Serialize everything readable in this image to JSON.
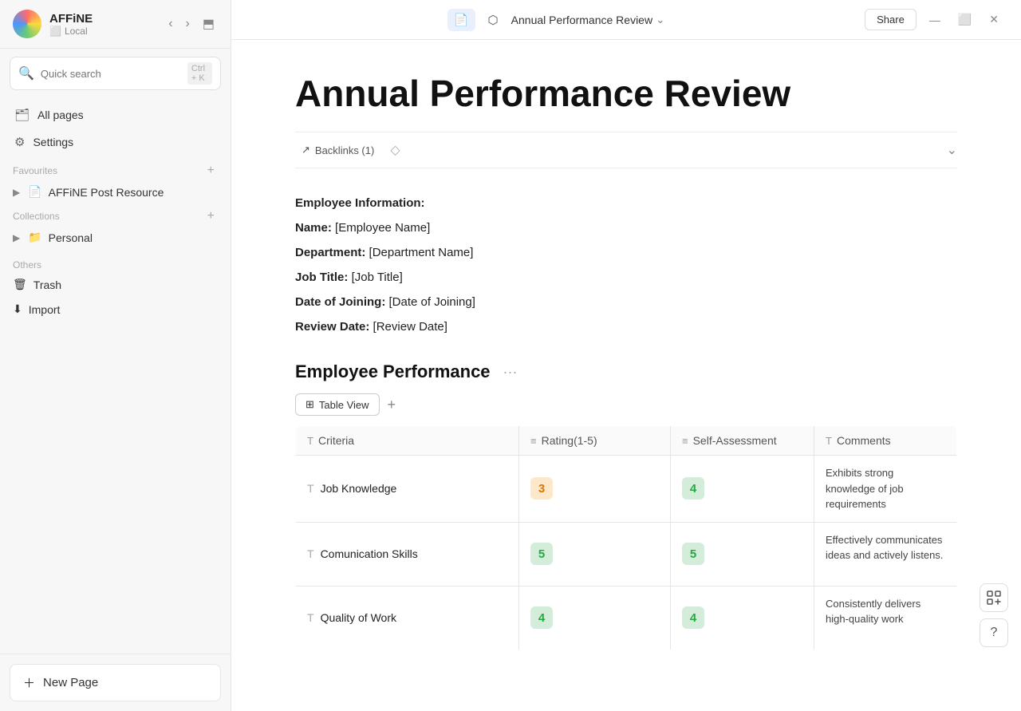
{
  "app": {
    "name": "AFFiNE",
    "workspace": "Local",
    "title": "Annual Performance Review"
  },
  "topbar": {
    "doc_icon": "📄",
    "graph_icon": "⬡",
    "share_label": "Share",
    "chevron_down": "⌄",
    "minimize": "—",
    "maximize": "⬜",
    "close": "✕"
  },
  "sidebar": {
    "search_placeholder": "Quick search",
    "search_shortcut": "Ctrl + K",
    "all_pages_label": "All pages",
    "settings_label": "Settings",
    "favourites_label": "Favourites",
    "favourites_item": "AFFiNE Post Resource",
    "collections_label": "Collections",
    "collections_item": "Personal",
    "others_label": "Others",
    "trash_label": "Trash",
    "import_label": "Import",
    "new_page_label": "New Page"
  },
  "document": {
    "title": "Annual Performance Review",
    "backlinks": "Backlinks (1)",
    "employee_info_heading": "Employee Information:",
    "name_label": "Name:",
    "name_value": "[Employee Name]",
    "department_label": "Department:",
    "department_value": "[Department Name]",
    "job_title_label": "Job Title:",
    "job_title_value": "[Job Title]",
    "date_of_joining_label": "Date of Joining:",
    "date_of_joining_value": "[Date of Joining]",
    "review_date_label": "Review Date:",
    "review_date_value": "[Review Date]"
  },
  "database": {
    "title": "Employee Performance",
    "view_label": "Table View",
    "add_view": "+",
    "columns": [
      {
        "label": "Criteria",
        "icon": "T"
      },
      {
        "label": "Rating(1-5)",
        "icon": "#"
      },
      {
        "label": "Self-Assessment",
        "icon": "#"
      },
      {
        "label": "Comments",
        "icon": "T"
      }
    ],
    "rows": [
      {
        "criteria": "Job Knowledge",
        "rating": "3",
        "rating_class": "badge-3",
        "self_assessment": "4",
        "self_class": "badge-4",
        "comment": "Exhibits strong knowledge of job requirements"
      },
      {
        "criteria": "Comunication Skills",
        "rating": "5",
        "rating_class": "badge-5",
        "self_assessment": "5",
        "self_class": "badge-5",
        "comment": "Effectively communicates ideas and actively listens."
      },
      {
        "criteria": "Quality of Work",
        "rating": "4",
        "rating_class": "badge-4",
        "self_assessment": "4",
        "self_class": "badge-4",
        "comment": "Consistently delivers high-quality work"
      }
    ]
  }
}
